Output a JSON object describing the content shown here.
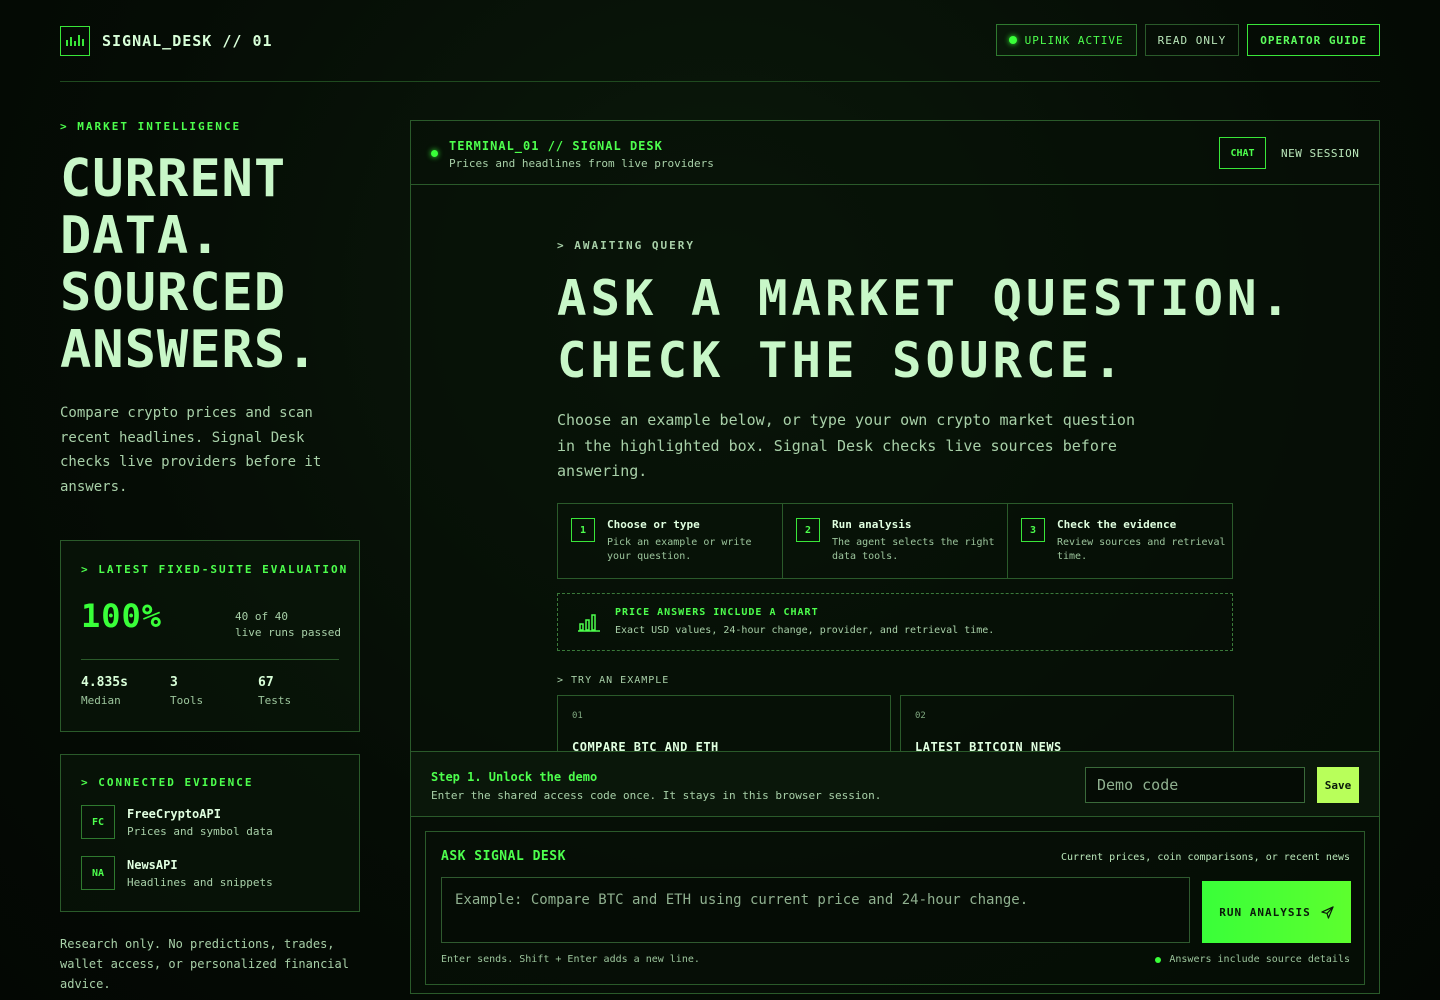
{
  "brand": {
    "title": "SIGNAL_DESK // 01"
  },
  "top_actions": {
    "uplink": "UPLINK ACTIVE",
    "read_only": "READ ONLY",
    "guide": "OPERATOR GUIDE"
  },
  "left": {
    "kicker": "> MARKET INTELLIGENCE",
    "title_lines": [
      "CURRENT",
      "DATA.",
      "SOURCED",
      "ANSWERS."
    ],
    "description": "Compare crypto prices and scan recent headlines. Signal Desk checks live providers before it answers."
  },
  "evaluation": {
    "kicker": "> LATEST FIXED-SUITE EVALUATION",
    "percent": "100%",
    "note_line1": "40 of 40",
    "note_line2": "live runs passed",
    "stats": [
      {
        "value": "4.835s",
        "label": "Median"
      },
      {
        "value": "3",
        "label": "Tools"
      },
      {
        "value": "67",
        "label": "Tests"
      }
    ]
  },
  "evidence": {
    "kicker": "> CONNECTED EVIDENCE",
    "providers": [
      {
        "badge": "FC",
        "name": "FreeCryptoAPI",
        "desc": "Prices and symbol data"
      },
      {
        "badge": "NA",
        "name": "NewsAPI",
        "desc": "Headlines and snippets"
      }
    ]
  },
  "disclaimer": "Research only. No predictions, trades, wallet access, or personalized financial advice.",
  "panel": {
    "title": "TERMINAL_01 // SIGNAL DESK",
    "subtitle": "Prices and headlines from live providers",
    "tab_chat": "CHAT",
    "new_session": "NEW SESSION",
    "kicker": "> AWAITING QUERY",
    "headline_1": "ASK A MARKET QUESTION.",
    "headline_2": "CHECK THE SOURCE.",
    "lead": "Choose an example below, or type your own crypto market question in the highlighted box. Signal Desk checks live sources before answering.",
    "steps": [
      {
        "num": "1",
        "title": "Choose or type",
        "desc": "Pick an example or write your question."
      },
      {
        "num": "2",
        "title": "Run analysis",
        "desc": "The agent selects the right data tools."
      },
      {
        "num": "3",
        "title": "Check the evidence",
        "desc": "Review sources and retrieval time."
      }
    ],
    "chart_note_title": "PRICE ANSWERS INCLUDE A CHART",
    "chart_note_desc": "Exact USD values, 24-hour change, provider, and retrieval time.",
    "try_kicker": "> TRY AN EXAMPLE",
    "examples": [
      {
        "num": "01",
        "label": "COMPARE BTC AND ETH"
      },
      {
        "num": "02",
        "label": "LATEST BITCOIN NEWS"
      }
    ]
  },
  "unlock": {
    "title": "Step 1. Unlock the demo",
    "desc": "Enter the shared access code once. It stays in this browser session.",
    "placeholder": "Demo code",
    "save": "Save"
  },
  "ask": {
    "title": "ASK SIGNAL DESK",
    "right_note": "Current prices, coin comparisons, or recent news",
    "placeholder": "Example: Compare BTC and ETH using current price and 24-hour change.",
    "run": "RUN ANALYSIS",
    "hint": "Enter sends. Shift + Enter adds a new line.",
    "source_note": "Answers include source details"
  },
  "colors": {
    "accent": "#39ff39",
    "save_button": "#b8ff5a",
    "border": "#2a5a2a"
  },
  "icons": {
    "brand": "equalizer-icon",
    "chart": "bar-chart-icon",
    "send": "send-icon"
  }
}
